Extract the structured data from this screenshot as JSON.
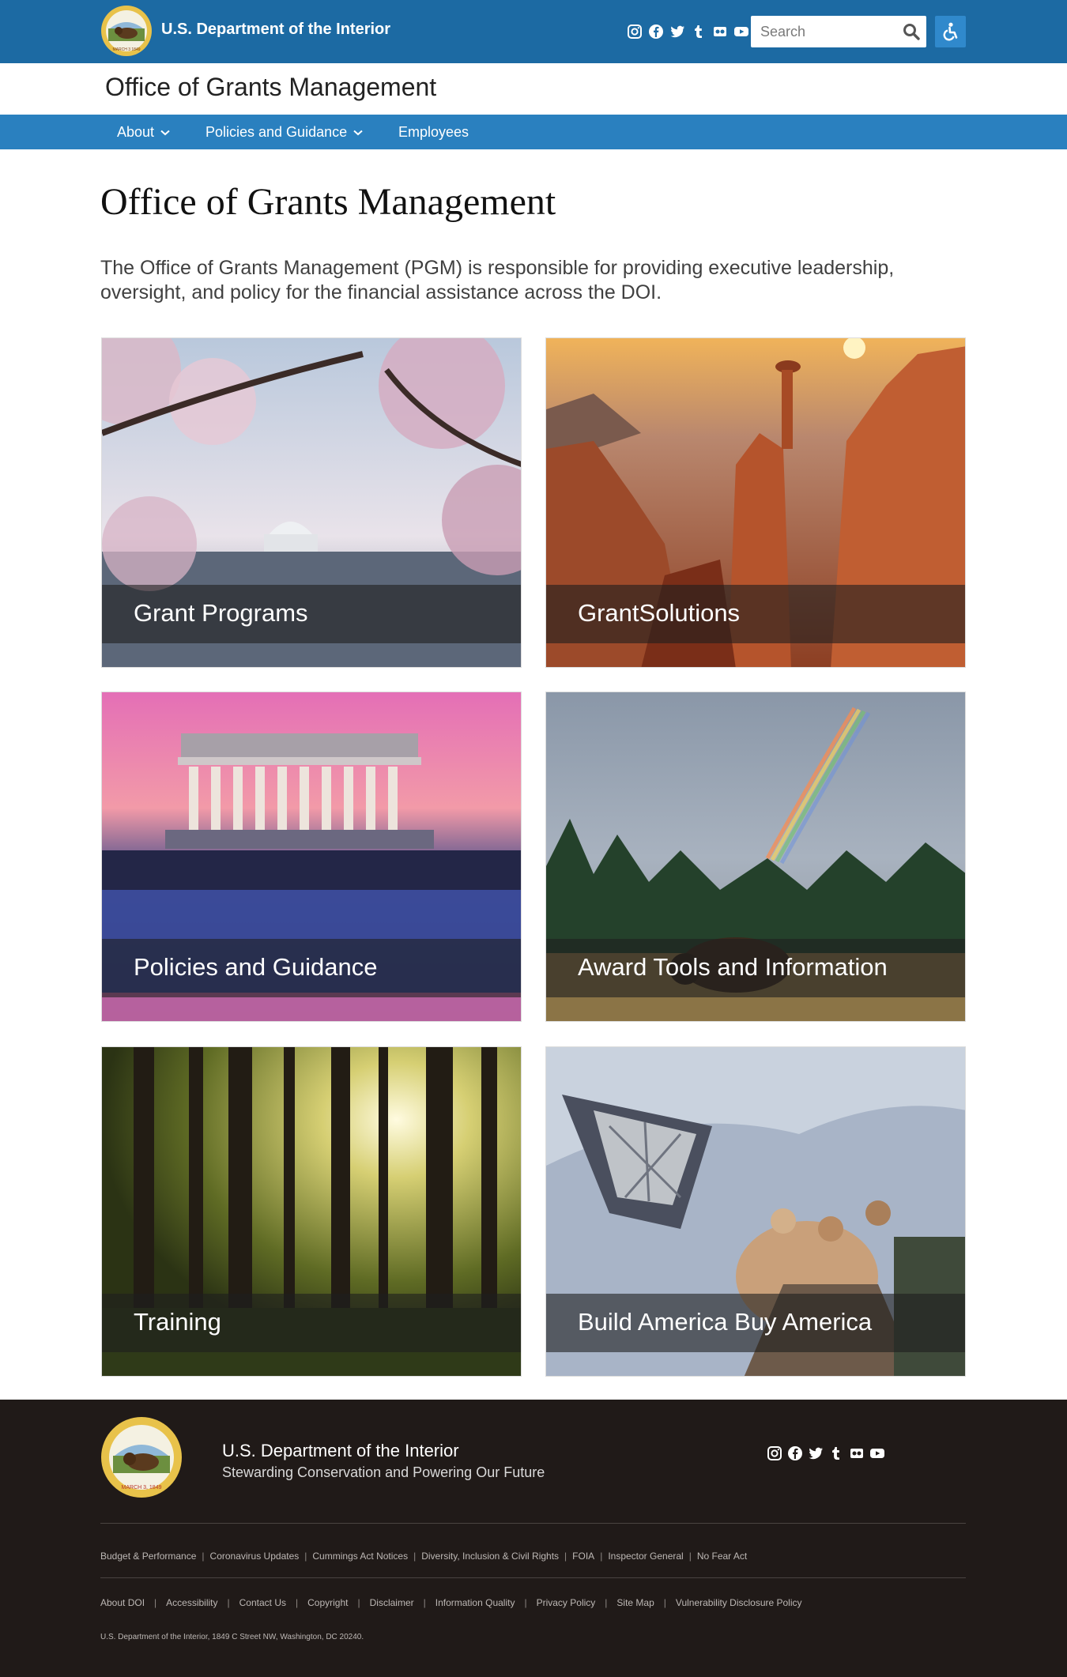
{
  "header": {
    "agency_name": "U.S. Department of the Interior",
    "social": [
      "instagram-icon",
      "facebook-icon",
      "twitter-icon",
      "tumblr-icon",
      "flickr-icon",
      "youtube-icon"
    ],
    "search": {
      "placeholder": "Search"
    },
    "accessibility_button": "accessibility-icon"
  },
  "site": {
    "title": "Office of Grants Management"
  },
  "nav": {
    "items": [
      {
        "label": "About",
        "has_dropdown": true
      },
      {
        "label": "Policies and Guidance",
        "has_dropdown": true
      },
      {
        "label": "Employees",
        "has_dropdown": false
      }
    ]
  },
  "main": {
    "heading": "Office of Grants Management",
    "intro": "The Office of Grants Management (PGM) is responsible for providing executive leadership, oversight, and policy for the financial assistance across the DOI.",
    "cards": [
      {
        "label": "Grant Programs"
      },
      {
        "label": "GrantSolutions"
      },
      {
        "label": "Policies and Guidance"
      },
      {
        "label": "Award Tools and Information"
      },
      {
        "label": "Training"
      },
      {
        "label": "Build America Buy America"
      }
    ]
  },
  "footer": {
    "name": "U.S. Department of the Interior",
    "tagline": "Stewarding Conservation and Powering Our Future",
    "links_row1": [
      "Budget & Performance",
      "Coronavirus Updates",
      "Cummings Act Notices",
      "Diversity, Inclusion & Civil Rights",
      "FOIA",
      "Inspector General",
      "No Fear Act"
    ],
    "links_row2": [
      "About DOI",
      "Accessibility",
      "Contact Us",
      "Copyright",
      "Disclaimer",
      "Information Quality",
      "Privacy Policy",
      "Site Map",
      "Vulnerability Disclosure Policy"
    ],
    "address": "U.S. Department of the Interior, 1849 C Street NW, Washington, DC 20240."
  },
  "colors": {
    "topbar": "#1c6aa3",
    "nav": "#2a80bf",
    "footer": "#201a18",
    "accent": "#3089cc"
  }
}
